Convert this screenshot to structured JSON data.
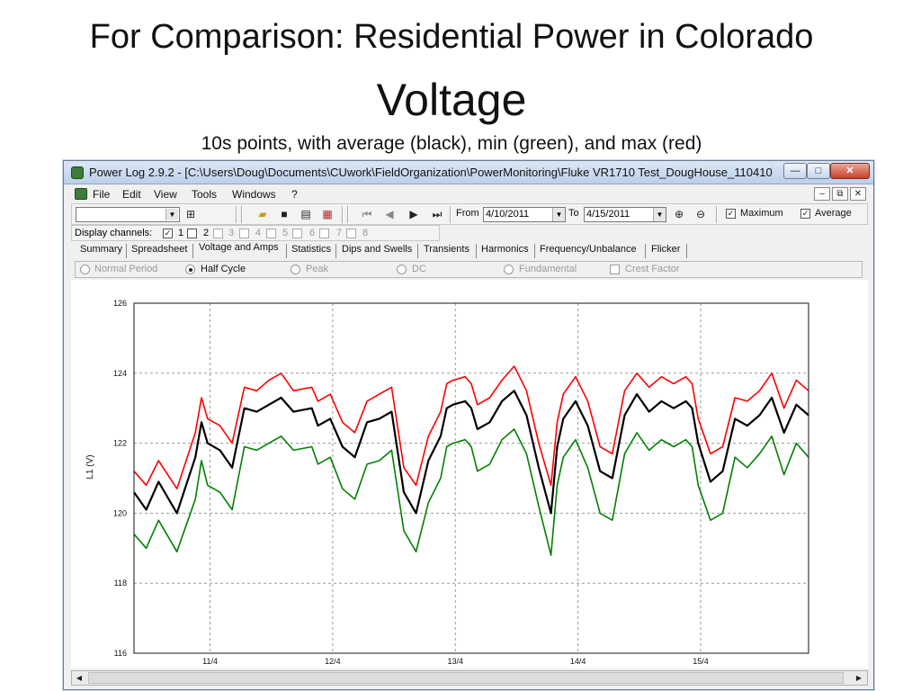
{
  "slide": {
    "title": "For Comparison: Residential Power in Colorado",
    "heading": "Voltage",
    "subtitle": "10s points, with average (black), min (green), and max (red)"
  },
  "window": {
    "title": "Power Log 2.9.2 - [C:\\Users\\Doug\\Documents\\CUwork\\FieldOrganization\\PowerMonitoring\\Fluke VR1710 Test_DougHouse_110410\\D...",
    "controls": {
      "minimize": "—",
      "maximize": "□",
      "close": "✕"
    }
  },
  "menu": {
    "items": [
      "File",
      "Edit",
      "View",
      "Tools",
      "Windows",
      "?"
    ],
    "mdi_controls": {
      "minimize": "–",
      "restore": "⧉",
      "close": "✕"
    }
  },
  "toolbar": {
    "combo_value": "",
    "icons": [
      "open-folder-icon",
      "save-icon",
      "print-icon",
      "export-icon",
      "first-icon",
      "prev-icon",
      "next-icon",
      "last-icon",
      "zoom-in-icon",
      "zoom-out-icon"
    ],
    "from_label": "From",
    "from_date": "4/10/2011",
    "to_label": "To",
    "to_date": "4/15/2011",
    "maximum_label": "Maximum",
    "maximum_checked": true,
    "average_label": "Average",
    "average_checked": true
  },
  "channels": {
    "label": "Display channels:",
    "items": [
      {
        "num": "1",
        "checked": true
      },
      {
        "num": "2",
        "checked": false
      },
      {
        "num": "3",
        "checked": false
      },
      {
        "num": "4",
        "checked": false
      },
      {
        "num": "5",
        "checked": false
      },
      {
        "num": "6",
        "checked": false
      },
      {
        "num": "7",
        "checked": false
      },
      {
        "num": "8",
        "checked": false
      }
    ]
  },
  "tabs": [
    "Summary",
    "Spreadsheet",
    "Voltage and Amps",
    "Statistics",
    "Dips and Swells",
    "Transients",
    "Harmonics",
    "Frequency/Unbalance",
    "Flicker"
  ],
  "active_tab": "Voltage and Amps",
  "options": {
    "normal_period": "Normal Period",
    "half_cycle": "Half Cycle",
    "peak": "Peak",
    "dc": "DC",
    "fundamental": "Fundamental",
    "crest_factor": "Crest Factor",
    "selected": "Half Cycle"
  },
  "colors": {
    "max": "#ff0000",
    "min": "#008000",
    "avg": "#000000",
    "grid": "#9a9a9a"
  },
  "chart_data": {
    "type": "line",
    "ylabel": "L1 (V)",
    "ylim": [
      116,
      126
    ],
    "yticks": [
      "116",
      "118",
      "120",
      "122",
      "124",
      "126"
    ],
    "xlim": [
      "4/10",
      "4/15 12:00"
    ],
    "xticks": [
      "11/4",
      "12/4",
      "13/4",
      "14/4",
      "15/4"
    ],
    "grid": true,
    "series": [
      {
        "key": "avg",
        "color": "#000000",
        "x_days": [
          0.0,
          0.1,
          0.2,
          0.35,
          0.5,
          0.55,
          0.6,
          0.7,
          0.8,
          0.9,
          1.0,
          1.1,
          1.2,
          1.3,
          1.45,
          1.5,
          1.6,
          1.7,
          1.8,
          1.9,
          2.0,
          2.1,
          2.2,
          2.3,
          2.4,
          2.5,
          2.55,
          2.6,
          2.7,
          2.75,
          2.8,
          2.9,
          3.0,
          3.1,
          3.2,
          3.3,
          3.4,
          3.45,
          3.5,
          3.6,
          3.7,
          3.8,
          3.9,
          4.0,
          4.1,
          4.2,
          4.3,
          4.4,
          4.5,
          4.55,
          4.6,
          4.7,
          4.8,
          4.9,
          5.0,
          5.1,
          5.2,
          5.3,
          5.4,
          5.5
        ],
        "values": [
          120.6,
          120.1,
          120.9,
          120.0,
          121.6,
          122.6,
          122.0,
          121.8,
          121.3,
          123.0,
          122.9,
          123.1,
          123.3,
          122.9,
          123.0,
          122.5,
          122.7,
          121.9,
          121.6,
          122.6,
          122.7,
          122.9,
          120.6,
          120.0,
          121.5,
          122.2,
          123.0,
          123.1,
          123.2,
          123.0,
          122.4,
          122.6,
          123.2,
          123.5,
          122.8,
          121.3,
          120.0,
          121.9,
          122.7,
          123.2,
          122.5,
          121.2,
          121.0,
          122.8,
          123.4,
          122.9,
          123.2,
          123.0,
          123.2,
          123.0,
          122.0,
          120.9,
          121.2,
          122.7,
          122.5,
          122.8,
          123.3,
          122.3,
          123.1,
          122.8
        ]
      },
      {
        "key": "min",
        "color": "#008000",
        "x_days": [
          0.0,
          0.1,
          0.2,
          0.35,
          0.5,
          0.55,
          0.6,
          0.7,
          0.8,
          0.9,
          1.0,
          1.1,
          1.2,
          1.3,
          1.45,
          1.5,
          1.6,
          1.7,
          1.8,
          1.9,
          2.0,
          2.1,
          2.2,
          2.3,
          2.4,
          2.5,
          2.55,
          2.6,
          2.7,
          2.75,
          2.8,
          2.9,
          3.0,
          3.1,
          3.2,
          3.3,
          3.4,
          3.45,
          3.5,
          3.6,
          3.7,
          3.8,
          3.9,
          4.0,
          4.1,
          4.2,
          4.3,
          4.4,
          4.5,
          4.55,
          4.6,
          4.7,
          4.8,
          4.9,
          5.0,
          5.1,
          5.2,
          5.3,
          5.4,
          5.5
        ],
        "values": [
          119.4,
          119.0,
          119.8,
          118.9,
          120.4,
          121.5,
          120.8,
          120.6,
          120.1,
          121.9,
          121.8,
          122.0,
          122.2,
          121.8,
          121.9,
          121.4,
          121.6,
          120.7,
          120.4,
          121.4,
          121.5,
          121.8,
          119.5,
          118.9,
          120.3,
          121.0,
          121.9,
          122.0,
          122.1,
          121.9,
          121.2,
          121.4,
          122.1,
          122.4,
          121.7,
          120.2,
          118.8,
          120.8,
          121.6,
          122.1,
          121.3,
          120.0,
          119.8,
          121.7,
          122.3,
          121.8,
          122.1,
          121.9,
          122.1,
          121.9,
          120.8,
          119.8,
          120.0,
          121.6,
          121.3,
          121.7,
          122.2,
          121.1,
          122.0,
          121.6
        ]
      },
      {
        "key": "max",
        "color": "#ff0000",
        "x_days": [
          0.0,
          0.1,
          0.2,
          0.35,
          0.5,
          0.55,
          0.6,
          0.7,
          0.8,
          0.9,
          1.0,
          1.1,
          1.2,
          1.3,
          1.45,
          1.5,
          1.6,
          1.7,
          1.8,
          1.9,
          2.0,
          2.1,
          2.2,
          2.3,
          2.4,
          2.5,
          2.55,
          2.6,
          2.7,
          2.75,
          2.8,
          2.9,
          3.0,
          3.1,
          3.2,
          3.3,
          3.4,
          3.45,
          3.5,
          3.6,
          3.7,
          3.8,
          3.9,
          4.0,
          4.1,
          4.2,
          4.3,
          4.4,
          4.5,
          4.55,
          4.6,
          4.7,
          4.8,
          4.9,
          5.0,
          5.1,
          5.2,
          5.3,
          5.4,
          5.5
        ],
        "values": [
          121.2,
          120.8,
          121.5,
          120.7,
          122.3,
          123.3,
          122.7,
          122.5,
          122.0,
          123.6,
          123.5,
          123.8,
          124.0,
          123.5,
          123.6,
          123.2,
          123.4,
          122.6,
          122.3,
          123.2,
          123.4,
          123.6,
          121.3,
          120.8,
          122.2,
          122.9,
          123.7,
          123.8,
          123.9,
          123.7,
          123.1,
          123.3,
          123.8,
          124.2,
          123.5,
          122.0,
          120.8,
          122.6,
          123.4,
          123.9,
          123.2,
          121.9,
          121.7,
          123.5,
          124.0,
          123.6,
          123.9,
          123.7,
          123.9,
          123.7,
          122.7,
          121.7,
          121.9,
          123.3,
          123.2,
          123.5,
          124.0,
          123.0,
          123.8,
          123.5
        ]
      }
    ]
  }
}
